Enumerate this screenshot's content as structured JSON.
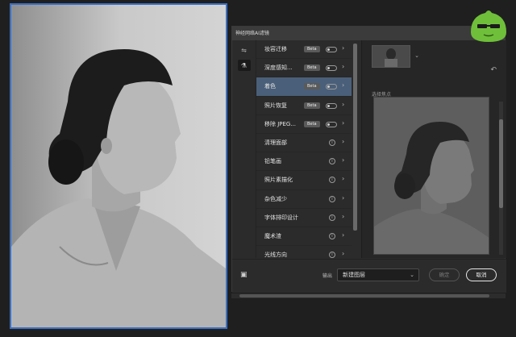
{
  "dialog": {
    "title": "神经网络AI滤镜",
    "filters": [
      {
        "label": "妆容迁移",
        "beta": "Beta",
        "control": "toggle",
        "selected": false
      },
      {
        "label": "深度感知...",
        "beta": "Beta",
        "control": "toggle",
        "selected": false
      },
      {
        "label": "着色",
        "beta": "Beta",
        "control": "toggle",
        "selected": true
      },
      {
        "label": "照片恢复",
        "beta": "Beta",
        "control": "toggle",
        "selected": false
      },
      {
        "label": "移除 JPEG...",
        "beta": "Beta",
        "control": "toggle",
        "selected": false
      },
      {
        "label": "清理面部",
        "beta": "",
        "control": "info",
        "selected": false
      },
      {
        "label": "铅笔画",
        "beta": "",
        "control": "info",
        "selected": false
      },
      {
        "label": "照片素描化",
        "beta": "",
        "control": "info",
        "selected": false
      },
      {
        "label": "杂色减少",
        "beta": "",
        "control": "info",
        "selected": false
      },
      {
        "label": "字体排印设计",
        "beta": "",
        "control": "info",
        "selected": false
      },
      {
        "label": "魔术渣",
        "beta": "",
        "control": "info",
        "selected": false
      },
      {
        "label": "光线方向",
        "beta": "",
        "control": "info",
        "selected": false
      }
    ],
    "preview": {
      "selection_label": "选择焦点"
    },
    "bottom": {
      "output_label": "输出",
      "output_value": "新建图层",
      "ok_label": "确定",
      "cancel_label": "取消"
    }
  },
  "colors": {
    "accent_selection": "#4a5f79",
    "canvas_border": "#3a6fc4",
    "mascot": "#6fbf3a"
  }
}
